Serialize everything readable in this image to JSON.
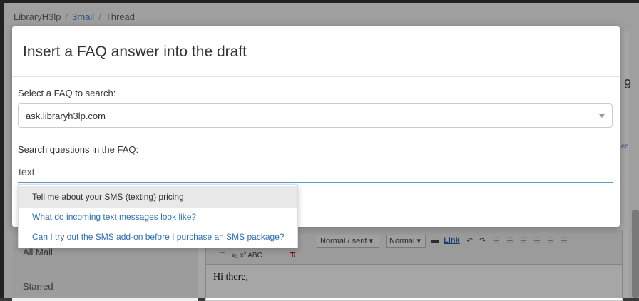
{
  "breadcrumb": {
    "root": "LibraryH3lp",
    "sep": "/",
    "mail": "3mail",
    "thread": "Thread"
  },
  "background": {
    "side_number": "9",
    "side_cc": "cc",
    "nav_items": [
      "All Mail",
      "Starred"
    ],
    "toolbar": {
      "font_select": "Normal / serif",
      "size_select": "Normal",
      "link_label": "Link",
      "row2": "x₂  x²  ABC"
    },
    "editor_text": "Hi there,"
  },
  "modal": {
    "title": "Insert a FAQ answer into the draft",
    "faq_select_label": "Select a FAQ to search:",
    "faq_select_value": "ask.libraryh3lp.com",
    "search_label": "Search questions in the FAQ:",
    "search_value": "text"
  },
  "suggestions": [
    {
      "label": "Tell me about your SMS (texting) pricing",
      "active": true
    },
    {
      "label": "What do incoming text messages look like?",
      "active": false
    },
    {
      "label": "Can I try out the SMS add-on before I purchase an SMS package?",
      "active": false
    }
  ],
  "colors": {
    "link": "#2f6fb3",
    "focus_underline": "#5b9bd5",
    "active_bg": "#e8e8e8"
  }
}
